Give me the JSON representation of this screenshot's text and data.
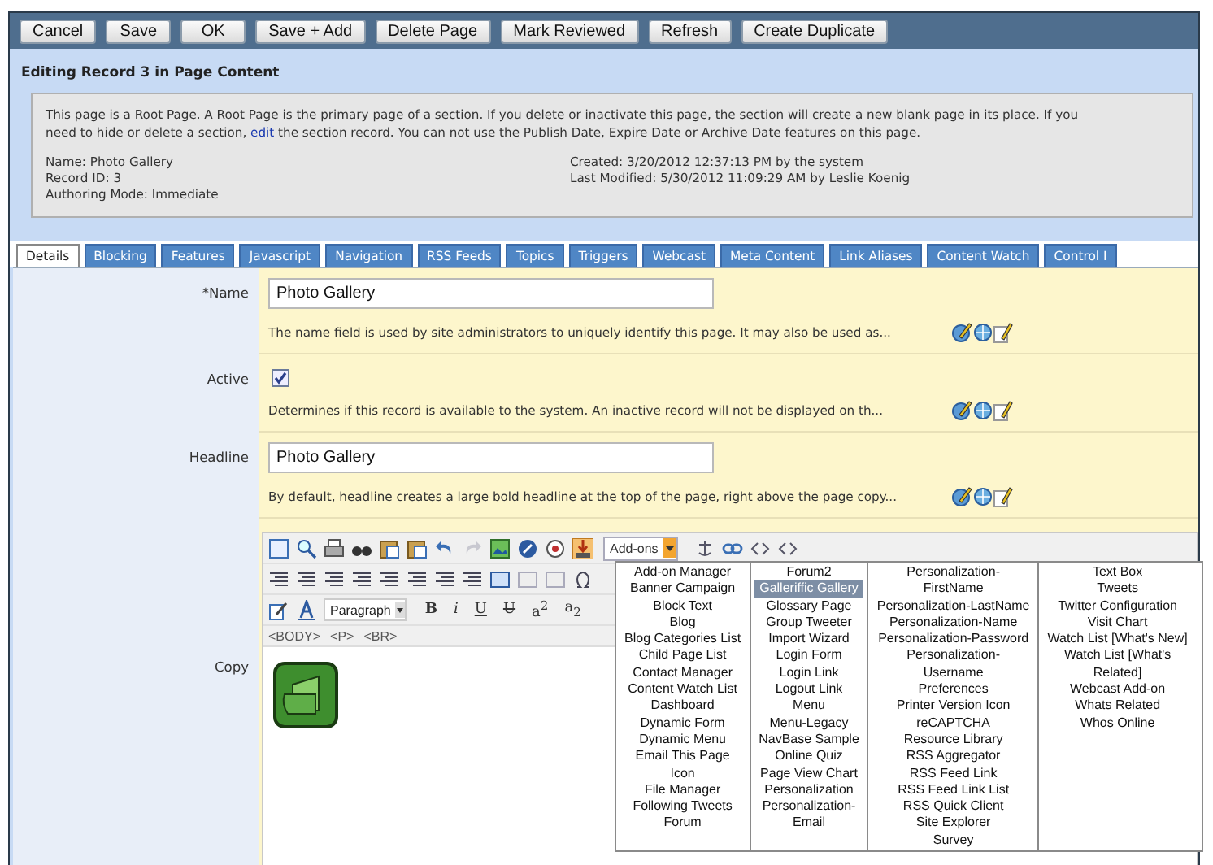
{
  "toolbar_buttons": [
    "Cancel",
    "Save",
    "OK",
    "Save + Add",
    "Delete Page",
    "Mark Reviewed",
    "Refresh",
    "Create Duplicate"
  ],
  "header": {
    "title": "Editing Record 3 in Page Content"
  },
  "notice": {
    "before": "This page is a Root Page. A Root Page is the primary page of a section. If you delete or inactivate this page, the section will create a new blank page in its place. If you need to hide or delete a section,",
    "link": "edit",
    "after": "the section record. You can not use the Publish Date, Expire Date or Archive Date features on this page."
  },
  "record_info": {
    "left": [
      "Name: Photo Gallery",
      "Record ID: 3",
      "Authoring Mode: Immediate"
    ],
    "right": [
      "Created: 3/20/2012 12:37:13 PM by the system",
      "Last Modified: 5/30/2012 11:09:29 AM by Leslie Koenig"
    ]
  },
  "tabs": [
    {
      "label": "Details",
      "selected": true
    },
    {
      "label": "Blocking",
      "selected": false
    },
    {
      "label": "Features",
      "selected": false
    },
    {
      "label": "Javascript",
      "selected": false
    },
    {
      "label": "Navigation",
      "selected": false
    },
    {
      "label": "RSS Feeds",
      "selected": false
    },
    {
      "label": "Topics",
      "selected": false
    },
    {
      "label": "Triggers",
      "selected": false
    },
    {
      "label": "Webcast",
      "selected": false
    },
    {
      "label": "Meta Content",
      "selected": false
    },
    {
      "label": "Link Aliases",
      "selected": false
    },
    {
      "label": "Content Watch",
      "selected": false
    },
    {
      "label": "Control I",
      "selected": false
    }
  ],
  "fields": [
    {
      "kind": "text",
      "label": "*Name",
      "value": "Photo Gallery",
      "help": "The name field is used by site administrators to uniquely identify this page. It may also be used as..."
    },
    {
      "kind": "checkbox",
      "label": "Active",
      "checked": true,
      "help": "Determines if this record is available to the system. An inactive record will not be displayed on th..."
    },
    {
      "kind": "text",
      "label": "Headline",
      "value": "Photo Gallery",
      "help": "By default, headline creates a large bold headline at the top of the page, right above the page copy..."
    }
  ],
  "editor": {
    "label": "Copy",
    "addons_label": "Add-ons",
    "format": "Paragraph",
    "format_buttons": [
      {
        "kind": "bold",
        "label": "B"
      },
      {
        "kind": "italic",
        "label": "i"
      },
      {
        "kind": "underline",
        "label": "U"
      },
      {
        "kind": "strike",
        "label": "U"
      },
      {
        "kind": "sup",
        "label": "a$^{2}$"
      },
      {
        "kind": "sub",
        "label": "a$_{2}$"
      }
    ],
    "path": [
      "<BODY>",
      "<P>",
      "<BR>"
    ],
    "menu": [
      [
        {
          "label": "Add-on Manager",
          "selected": false
        },
        {
          "label": "Banner Campaign",
          "selected": false
        },
        {
          "label": "Block Text",
          "selected": false
        },
        {
          "label": "Blog",
          "selected": false
        },
        {
          "label": "Blog Categories List",
          "selected": false
        },
        {
          "label": "Child Page List",
          "selected": false
        },
        {
          "label": "Contact Manager",
          "selected": false
        },
        {
          "label": "Content Watch List",
          "selected": false
        },
        {
          "label": "Dashboard",
          "selected": false
        },
        {
          "label": "Dynamic Form",
          "selected": false
        },
        {
          "label": "Dynamic Menu",
          "selected": false
        },
        {
          "label": "Email This Page\nIcon",
          "selected": false
        },
        {
          "label": "File Manager",
          "selected": false
        },
        {
          "label": "Following Tweets",
          "selected": false
        },
        {
          "label": "Forum",
          "selected": false
        }
      ],
      [
        {
          "label": "Forum2",
          "selected": false
        },
        {
          "label": "Galleriffic Gallery",
          "selected": true
        },
        {
          "label": "Glossary Page",
          "selected": false
        },
        {
          "label": "Group Tweeter",
          "selected": false
        },
        {
          "label": "Import Wizard",
          "selected": false
        },
        {
          "label": "Login Form",
          "selected": false
        },
        {
          "label": "Login Link",
          "selected": false
        },
        {
          "label": "Logout Link",
          "selected": false
        },
        {
          "label": "Menu",
          "selected": false
        },
        {
          "label": "Menu-Legacy",
          "selected": false
        },
        {
          "label": "NavBase Sample",
          "selected": false
        },
        {
          "label": "Online Quiz",
          "selected": false
        },
        {
          "label": "Page View Chart",
          "selected": false
        },
        {
          "label": "Personalization",
          "selected": false
        },
        {
          "label": "Personalization-\nEmail",
          "selected": false
        }
      ],
      [
        {
          "label": "Personalization-\nFirstName",
          "selected": false
        },
        {
          "label": "Personalization-LastName",
          "selected": false
        },
        {
          "label": "Personalization-Name",
          "selected": false
        },
        {
          "label": "Personalization-Password",
          "selected": false
        },
        {
          "label": "Personalization-\nUsername",
          "selected": false
        },
        {
          "label": "Preferences",
          "selected": false
        },
        {
          "label": "Printer Version Icon",
          "selected": false
        },
        {
          "label": "reCAPTCHA",
          "selected": false
        },
        {
          "label": "Resource Library",
          "selected": false
        },
        {
          "label": "RSS Aggregator",
          "selected": false
        },
        {
          "label": "RSS Feed Link",
          "selected": false
        },
        {
          "label": "RSS Feed Link List",
          "selected": false
        },
        {
          "label": "RSS Quick Client",
          "selected": false
        },
        {
          "label": "Site Explorer",
          "selected": false
        },
        {
          "label": "Survey",
          "selected": false
        }
      ],
      [
        {
          "label": "Text Box",
          "selected": false
        },
        {
          "label": "Tweets",
          "selected": false
        },
        {
          "label": "Twitter Configuration",
          "selected": false
        },
        {
          "label": "Visit Chart",
          "selected": false
        },
        {
          "label": "Watch List [What's New]",
          "selected": false
        },
        {
          "label": "Watch List [What's\nRelated]",
          "selected": false
        },
        {
          "label": "Webcast Add-on",
          "selected": false
        },
        {
          "label": "Whats Related",
          "selected": false
        },
        {
          "label": "Whos Online",
          "selected": false
        }
      ]
    ]
  }
}
